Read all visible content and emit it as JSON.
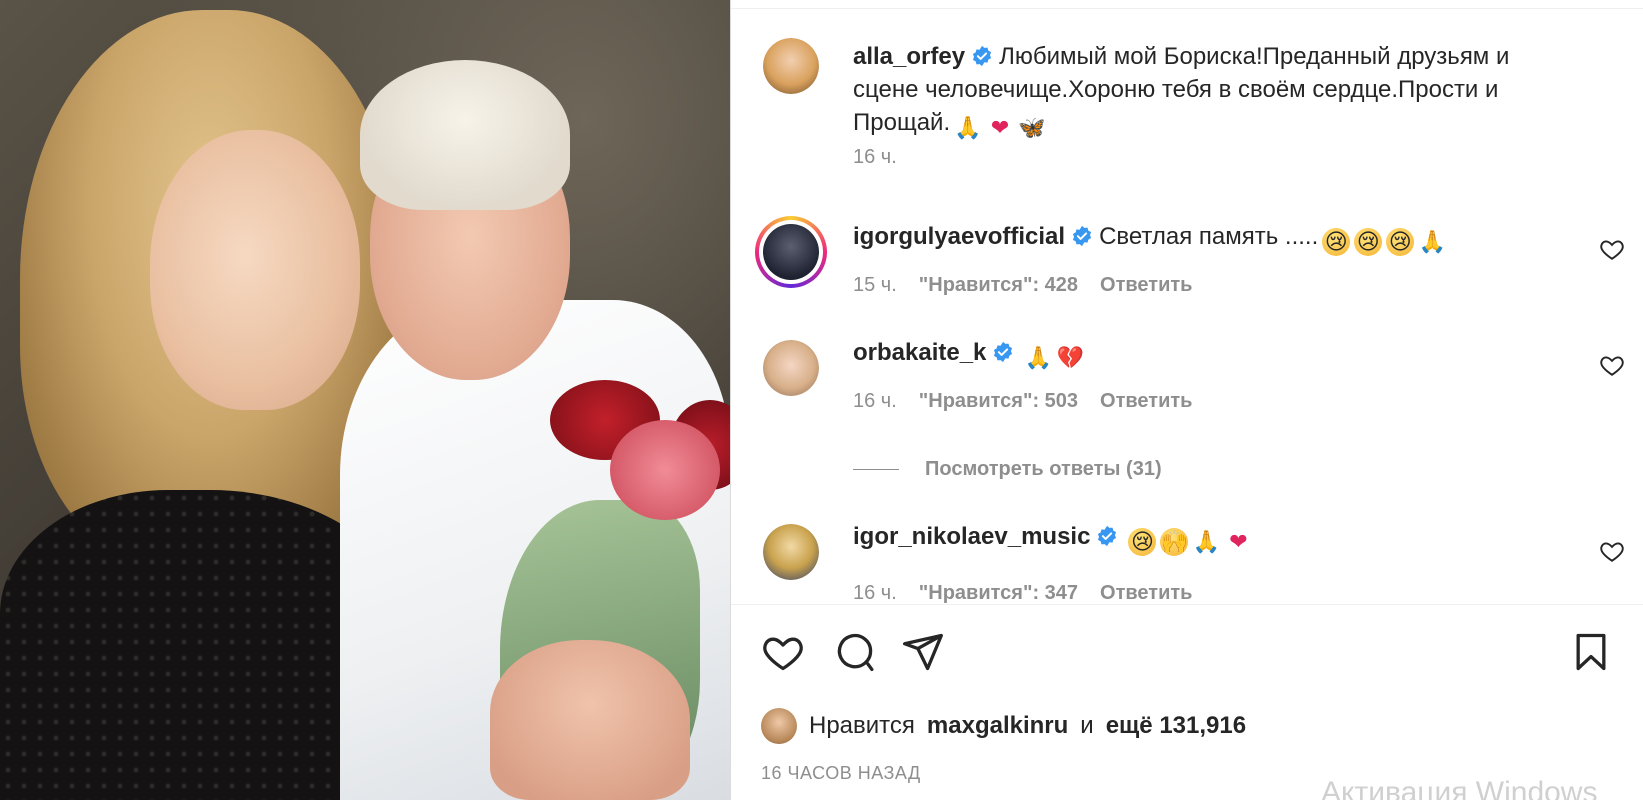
{
  "caption": {
    "username": "alla_orfey",
    "text": "Любимый мой Бориска!Преданный друзьям и сцене человечище.Хороню тебя в своём сердце.Прости и Прощай.",
    "emojis": [
      "🙏",
      "❤",
      "🦋"
    ],
    "time": "16 ч."
  },
  "comments": [
    {
      "username": "igorgulyaevofficial",
      "text": "Светлая память .....",
      "emojis": [
        "😢",
        "😢",
        "😢",
        "🙏"
      ],
      "time": "15 ч.",
      "likes": "\"Нравится\": 428",
      "reply": "Ответить"
    },
    {
      "username": "orbakaite_k",
      "text": "",
      "emojis": [
        "🙏",
        "💔"
      ],
      "time": "16 ч.",
      "likes": "\"Нравится\": 503",
      "reply": "Ответить"
    },
    {
      "username": "igor_nikolaev_music",
      "text": "",
      "emojis": [
        "😢",
        "🙌",
        "🙏",
        "❤"
      ],
      "time": "16 ч.",
      "likes": "\"Нравится\": 347",
      "reply": "Ответить"
    }
  ],
  "view_replies": "Посмотреть ответы (31)",
  "likes_line": {
    "prefix": "Нравится",
    "user": "maxgalkinru",
    "middle": "и",
    "rest": "ещё 131,916"
  },
  "time_ago": "16 ЧАСОВ НАЗАД",
  "watermark": "Активация Windows",
  "icons": {
    "verified": "verified-badge-icon",
    "like": "heart-icon",
    "comment": "comment-bubble-icon",
    "share": "paper-plane-icon",
    "save": "bookmark-icon"
  },
  "colors": {
    "verified": "#3897f0",
    "text": "#262626",
    "muted": "#8e8e8e"
  }
}
